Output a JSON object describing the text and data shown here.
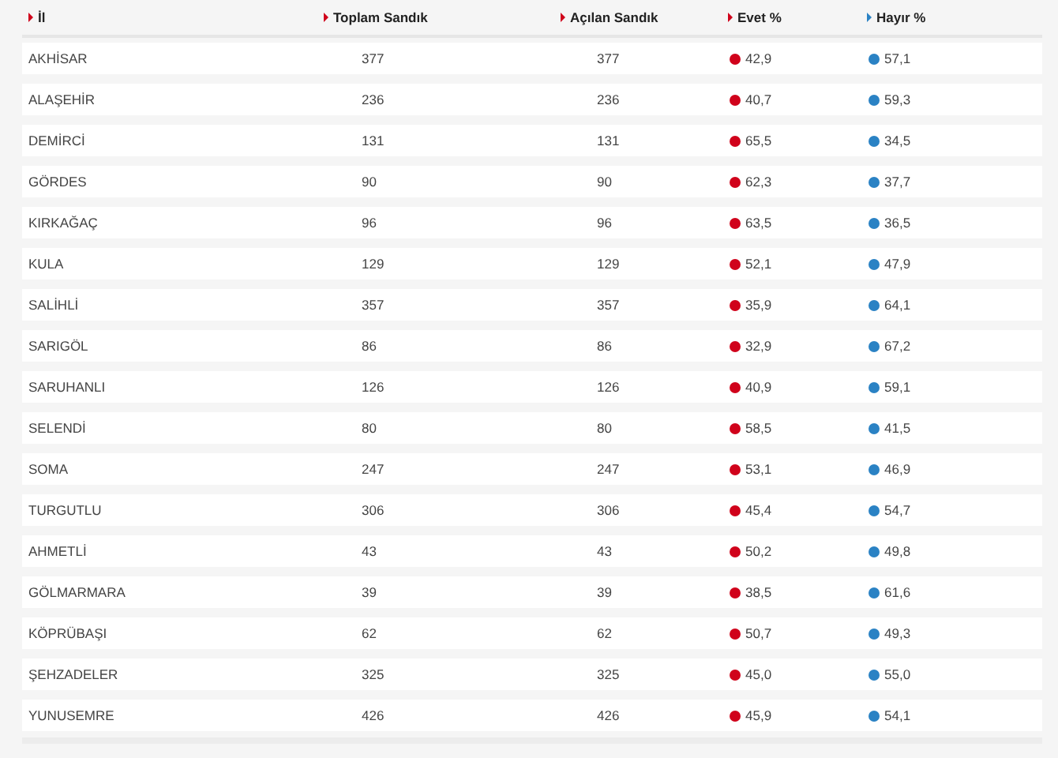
{
  "table": {
    "columns": [
      {
        "label": "İl",
        "color": "#d0021b",
        "kind": "text"
      },
      {
        "label": "Toplam Sandık",
        "color": "#d0021b",
        "kind": "number"
      },
      {
        "label": "Açılan Sandık",
        "color": "#d0021b",
        "kind": "number"
      },
      {
        "label": "Evet %",
        "color": "#d0021b",
        "kind": "dot"
      },
      {
        "label": "Hayır %",
        "color": "#2a82c4",
        "kind": "dot"
      }
    ],
    "rows": [
      [
        "AKHİSAR",
        "377",
        "377",
        "42,9",
        "57,1"
      ],
      [
        "ALAŞEHİR",
        "236",
        "236",
        "40,7",
        "59,3"
      ],
      [
        "DEMİRCİ",
        "131",
        "131",
        "65,5",
        "34,5"
      ],
      [
        "GÖRDES",
        "90",
        "90",
        "62,3",
        "37,7"
      ],
      [
        "KIRKAĞAÇ",
        "96",
        "96",
        "63,5",
        "36,5"
      ],
      [
        "KULA",
        "129",
        "129",
        "52,1",
        "47,9"
      ],
      [
        "SALİHLİ",
        "357",
        "357",
        "35,9",
        "64,1"
      ],
      [
        "SARIGÖL",
        "86",
        "86",
        "32,9",
        "67,2"
      ],
      [
        "SARUHANLI",
        "126",
        "126",
        "40,9",
        "59,1"
      ],
      [
        "SELENDİ",
        "80",
        "80",
        "58,5",
        "41,5"
      ],
      [
        "SOMA",
        "247",
        "247",
        "53,1",
        "46,9"
      ],
      [
        "TURGUTLU",
        "306",
        "306",
        "45,4",
        "54,7"
      ],
      [
        "AHMETLİ",
        "43",
        "43",
        "50,2",
        "49,8"
      ],
      [
        "GÖLMARMARA",
        "39",
        "39",
        "38,5",
        "61,6"
      ],
      [
        "KÖPRÜBAŞI",
        "62",
        "62",
        "50,7",
        "49,3"
      ],
      [
        "ŞEHZADELER",
        "325",
        "325",
        "45,0",
        "55,0"
      ],
      [
        "YUNUSEMRE",
        "426",
        "426",
        "45,9",
        "54,1"
      ]
    ]
  }
}
